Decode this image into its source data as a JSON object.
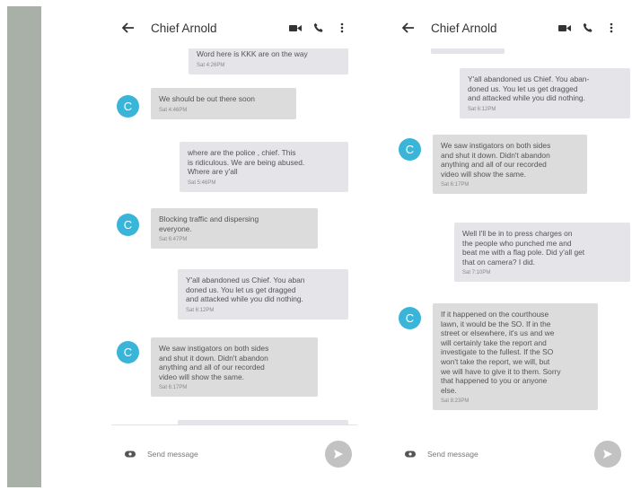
{
  "screens": [
    {
      "title": "Chief Arnold",
      "compose_placeholder": "Send message",
      "messages": [
        {
          "dir": "out",
          "text": "Word here is KKK are on the way",
          "time": "Sat 4:26PM"
        },
        {
          "dir": "in",
          "avatar": "C",
          "text": "We should be out there soon",
          "time": "Sat 4:46PM"
        },
        {
          "dir": "out",
          "text": "where are the police , chief. This\nis ridiculous. We are being abused.\nWhere are y'all",
          "time": "Sat 5:46PM"
        },
        {
          "dir": "in",
          "avatar": "C",
          "text": "Blocking traffic and dispersing\neveryone.",
          "time": "Sat 6:47PM"
        },
        {
          "dir": "out",
          "text": "Y'all abandoned us Chief. You aban\ndoned us. You let us get dragged\nand attacked while you did nothing.",
          "time": "Sat 6:12PM"
        },
        {
          "dir": "in",
          "avatar": "C",
          "text": "We saw instigators on both sides\nand shut it down. Didn't abandon\nanything and all of our recorded\nvideo will show the same.",
          "time": "Sat 6:17PM"
        }
      ]
    },
    {
      "title": "Chief Arnold",
      "compose_placeholder": "Send message",
      "messages": [
        {
          "dir": "out",
          "text": "Y'all abandoned us Chief. You aban-\ndoned us. You let us get dragged\nand attacked while you did nothing.",
          "time": "Sat 6:12PM"
        },
        {
          "dir": "in",
          "avatar": "C",
          "text": "We saw instigators on both sides\nand shut it down. Didn't abandon\nanything and all of our recorded\nvideo will show the same.",
          "time": "Sat 6:17PM"
        },
        {
          "dir": "out",
          "text": "Well I'll be in to press charges on\nthe people who punched me and\nbeat me with a flag pole. Did y'all get\nthat on camera? I did.",
          "time": "Sat 7:10PM"
        },
        {
          "dir": "in",
          "avatar": "C",
          "text": "If it happened on the courthouse\nlawn, it would be the SO. If in the\nstreet or elsewhere, it's us and we\nwill certainly take the report and\ninvestigate to the fullest. If the SO\nwon't take the report, we will, but\nwe will have to give it to them. Sorry\nthat happened to you or anyone\nelse.",
          "time": "Sat 8:23PM"
        }
      ]
    }
  ]
}
